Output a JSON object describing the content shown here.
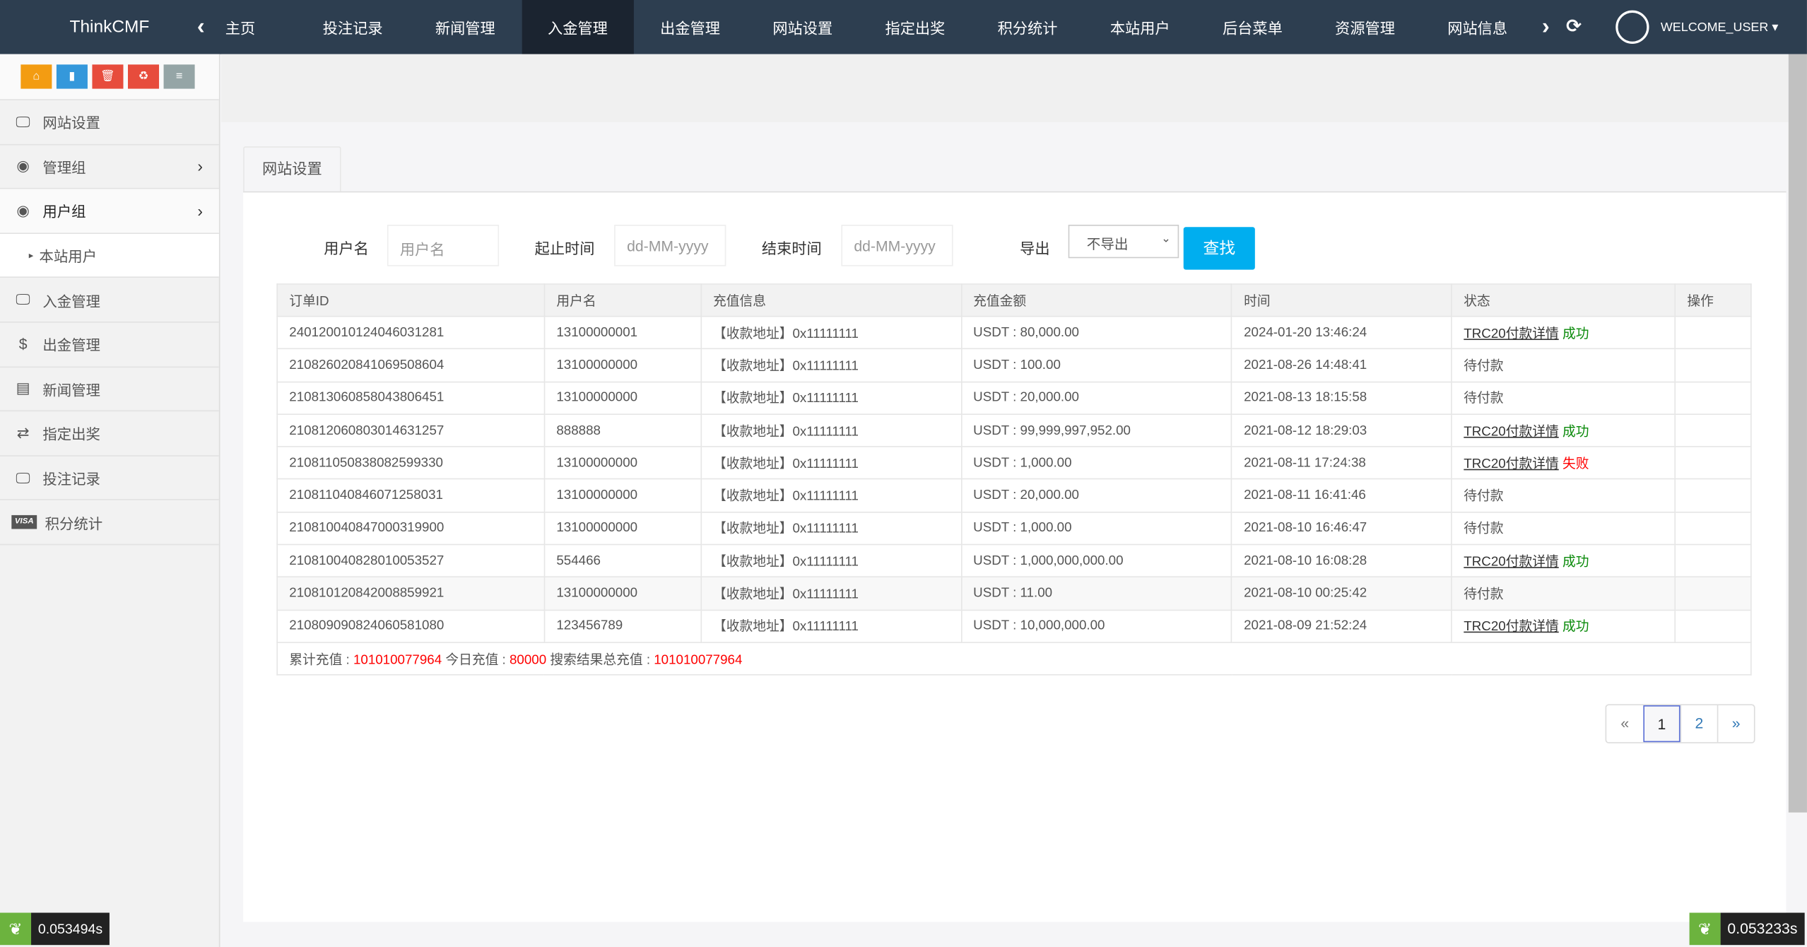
{
  "nav": {
    "brand": "ThinkCMF",
    "items": [
      "主页",
      "投注记录",
      "新闻管理",
      "入金管理",
      "出金管理",
      "网站设置",
      "指定出奖",
      "积分统计",
      "本站用户",
      "后台菜单",
      "资源管理",
      "网站信息"
    ],
    "active": "入金管理",
    "user": "WELCOME_USER ▾"
  },
  "sidebar": {
    "tools": [
      "home-icon",
      "file-icon",
      "trash-icon",
      "recycle-icon",
      "list-icon"
    ],
    "items": [
      {
        "label": "网站设置",
        "icon": "monitor-icon"
      },
      {
        "label": "管理组",
        "icon": "user-circle-icon"
      },
      {
        "label": "用户组",
        "icon": "user-circle-icon"
      },
      {
        "label": "本站用户",
        "icon": "caret-right-icon"
      },
      {
        "label": "入金管理",
        "icon": "monitor-icon"
      },
      {
        "label": "出金管理",
        "icon": "dollar-icon"
      },
      {
        "label": "新闻管理",
        "icon": "newspaper-icon"
      },
      {
        "label": "指定出奖",
        "icon": "exchange-icon"
      },
      {
        "label": "投注记录",
        "icon": "monitor-icon"
      },
      {
        "label": "积分统计",
        "icon": "visa-icon"
      }
    ]
  },
  "tab": "网站设置",
  "filter": {
    "username_label": "用户名",
    "username_placeholder": "用户名",
    "start_label": "起止时间",
    "start_placeholder": "dd-MM-yyyy",
    "end_label": "结束时间",
    "end_placeholder": "dd-MM-yyyy",
    "export_label": "导出",
    "export_value": "不导出",
    "search": "查找"
  },
  "table": {
    "headers": [
      "订单ID",
      "用户名",
      "充值信息",
      "充值金额",
      "时间",
      "状态",
      "操作"
    ],
    "rows": [
      [
        "240120010124046031281",
        "13100000001",
        "【收款地址】0x11111111",
        "USDT : 80,000.00",
        "2024-01-20 13:46:24",
        "TRC20付款详情",
        "成功"
      ],
      [
        "210826020841069508604",
        "13100000000",
        "【收款地址】0x11111111",
        "USDT : 100.00",
        "2021-08-26 14:48:41",
        "待付款",
        ""
      ],
      [
        "210813060858043806451",
        "13100000000",
        "【收款地址】0x11111111",
        "USDT : 20,000.00",
        "2021-08-13 18:15:58",
        "待付款",
        ""
      ],
      [
        "210812060803014631257",
        "888888",
        "【收款地址】0x11111111",
        "USDT : 99,999,997,952.00",
        "2021-08-12 18:29:03",
        "TRC20付款详情",
        "成功"
      ],
      [
        "210811050838082599330",
        "13100000000",
        "【收款地址】0x11111111",
        "USDT : 1,000.00",
        "2021-08-11 17:24:38",
        "TRC20付款详情",
        "失败"
      ],
      [
        "210811040846071258031",
        "13100000000",
        "【收款地址】0x11111111",
        "USDT : 20,000.00",
        "2021-08-11 16:41:46",
        "待付款",
        ""
      ],
      [
        "210810040847000319900",
        "13100000000",
        "【收款地址】0x11111111",
        "USDT : 1,000.00",
        "2021-08-10 16:46:47",
        "待付款",
        ""
      ],
      [
        "210810040828010053527",
        "554466",
        "【收款地址】0x11111111",
        "USDT : 1,000,000,000.00",
        "2021-08-10 16:08:28",
        "TRC20付款详情",
        "成功"
      ],
      [
        "210810120842008859921",
        "13100000000",
        "【收款地址】0x11111111",
        "USDT : 11.00",
        "2021-08-10 00:25:42",
        "待付款",
        ""
      ],
      [
        "210809090824060581080",
        "123456789",
        "【收款地址】0x11111111",
        "USDT : 10,000,000.00",
        "2021-08-09 21:52:24",
        "TRC20付款详情",
        "成功"
      ]
    ],
    "summary": {
      "total_label": "累计充值 : ",
      "total": "101010077964",
      "today_label": " 今日充值 : ",
      "today": "80000",
      "search_label": " 搜索结果总充值 : ",
      "search_total": "101010077964"
    }
  },
  "pagination": {
    "prev": "«",
    "pages": [
      "1",
      "2"
    ],
    "current": "1",
    "next": "»"
  },
  "timers": [
    "0.053494s",
    "0.053233s"
  ],
  "colors": {
    "nav": "#2d3e50",
    "success": "#0a8a0a",
    "fail": "#ff0000",
    "search_button": "#00aeef"
  }
}
